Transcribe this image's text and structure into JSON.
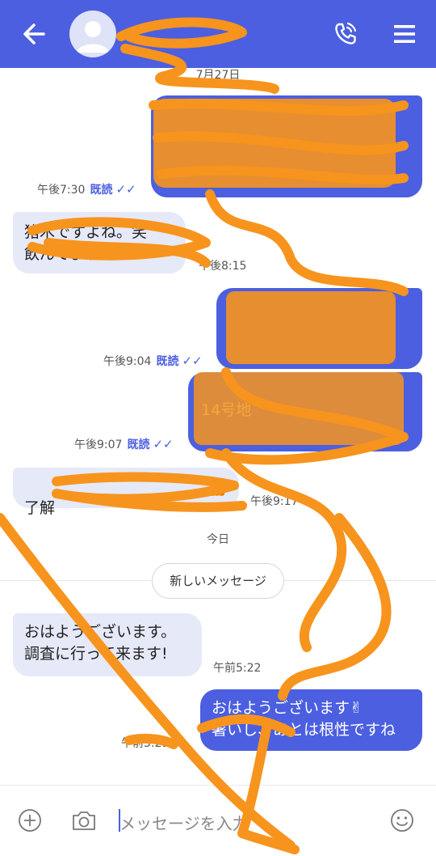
{
  "header": {
    "contact_name": "",
    "back_icon": "arrow-left-icon",
    "call_icon": "phone-call-icon",
    "menu_icon": "hamburger-menu-icon"
  },
  "dates": {
    "first": "7月27日",
    "today": "今日"
  },
  "new_messages_label": "新しいメッセージ",
  "messages": [
    {
      "dir": "out",
      "text": "",
      "time": "午後7:30",
      "read": "既読"
    },
    {
      "dir": "in",
      "text": "猪木ですよね。笑\n飲んでます。",
      "time": "午後8:15"
    },
    {
      "dir": "out",
      "text": "",
      "time": "午後9:04",
      "read": "既読"
    },
    {
      "dir": "out",
      "text": "14号地",
      "time": "午後9:07",
      "read": "既読"
    },
    {
      "dir": "in",
      "text": "了解",
      "time": "午後9:17"
    },
    {
      "dir": "in",
      "text": "おはようございます。\n調査に行って来ます!",
      "time": "午前5:22"
    },
    {
      "dir": "out",
      "text": "おはようございます✌\n暑いし、あとは根性ですね",
      "time": "午前5:29"
    }
  ],
  "input": {
    "placeholder": "メッセージを入力",
    "add_icon": "plus-circle-icon",
    "camera_icon": "camera-icon",
    "emoji_icon": "smiley-icon"
  },
  "colors": {
    "accent": "#4b5fe0",
    "incoming_bubble": "#e6e9f8",
    "scribble": "#f7941d"
  }
}
